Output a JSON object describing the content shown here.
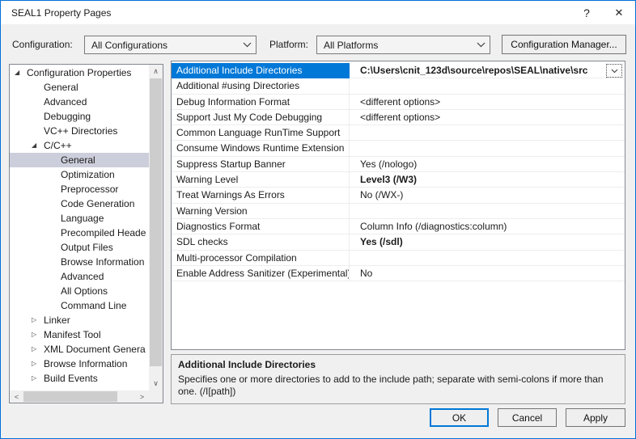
{
  "window": {
    "title": "SEAL1 Property Pages",
    "help_glyph": "?",
    "close_glyph": "✕"
  },
  "toolbar": {
    "configuration_label": "Configuration:",
    "configuration_value": "All Configurations",
    "platform_label": "Platform:",
    "platform_value": "All Platforms",
    "config_manager_label": "Configuration Manager..."
  },
  "icons": {
    "expanded": "◢",
    "collapsed": "▷",
    "up": "∧",
    "down": "∨",
    "left": "<",
    "right": ">"
  },
  "tree": {
    "items": [
      {
        "label": "Configuration Properties",
        "level": 1,
        "arrow": "expanded"
      },
      {
        "label": "General",
        "level": 2
      },
      {
        "label": "Advanced",
        "level": 2
      },
      {
        "label": "Debugging",
        "level": 2
      },
      {
        "label": "VC++ Directories",
        "level": 2
      },
      {
        "label": "C/C++",
        "level": 2,
        "arrow": "expanded"
      },
      {
        "label": "General",
        "level": 3,
        "selected": true
      },
      {
        "label": "Optimization",
        "level": 3
      },
      {
        "label": "Preprocessor",
        "level": 3
      },
      {
        "label": "Code Generation",
        "level": 3
      },
      {
        "label": "Language",
        "level": 3
      },
      {
        "label": "Precompiled Heade",
        "level": 3
      },
      {
        "label": "Output Files",
        "level": 3
      },
      {
        "label": "Browse Information",
        "level": 3
      },
      {
        "label": "Advanced",
        "level": 3
      },
      {
        "label": "All Options",
        "level": 3
      },
      {
        "label": "Command Line",
        "level": 3
      },
      {
        "label": "Linker",
        "level": 2,
        "arrow": "collapsed"
      },
      {
        "label": "Manifest Tool",
        "level": 2,
        "arrow": "collapsed"
      },
      {
        "label": "XML Document Genera",
        "level": 2,
        "arrow": "collapsed"
      },
      {
        "label": "Browse Information",
        "level": 2,
        "arrow": "collapsed"
      },
      {
        "label": "Build Events",
        "level": 2,
        "arrow": "collapsed"
      }
    ]
  },
  "grid": {
    "rows": [
      {
        "name": "Additional Include Directories",
        "value": "C:\\Users\\cnit_123d\\source\\repos\\SEAL\\native\\src",
        "selected": true,
        "bold": true,
        "dropdown": true
      },
      {
        "name": "Additional #using Directories",
        "value": ""
      },
      {
        "name": "Debug Information Format",
        "value": "<different options>"
      },
      {
        "name": "Support Just My Code Debugging",
        "value": "<different options>"
      },
      {
        "name": "Common Language RunTime Support",
        "value": ""
      },
      {
        "name": "Consume Windows Runtime Extension",
        "value": ""
      },
      {
        "name": "Suppress Startup Banner",
        "value": "Yes (/nologo)"
      },
      {
        "name": "Warning Level",
        "value": "Level3 (/W3)",
        "bold": true
      },
      {
        "name": "Treat Warnings As Errors",
        "value": "No (/WX-)"
      },
      {
        "name": "Warning Version",
        "value": ""
      },
      {
        "name": "Diagnostics Format",
        "value": "Column Info (/diagnostics:column)"
      },
      {
        "name": "SDL checks",
        "value": "Yes (/sdl)",
        "bold": true
      },
      {
        "name": "Multi-processor Compilation",
        "value": ""
      },
      {
        "name": "Enable Address Sanitizer (Experimental)",
        "value": "No"
      }
    ]
  },
  "description": {
    "title": "Additional Include Directories",
    "text": "Specifies one or more directories to add to the include path; separate with semi-colons if more than one. (/I[path])"
  },
  "buttons": {
    "ok": "OK",
    "cancel": "Cancel",
    "apply": "Apply"
  }
}
